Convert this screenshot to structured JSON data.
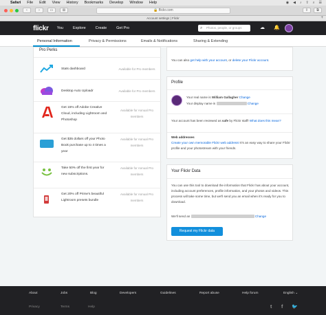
{
  "menubar": {
    "items": [
      "Safari",
      "File",
      "Edit",
      "View",
      "History",
      "Bookmarks",
      "Develop",
      "Window",
      "Help"
    ],
    "status": [
      "◉",
      "◀",
      "♪",
      "⇪",
      "⌕",
      "☰"
    ]
  },
  "browser": {
    "url": "🔒 flickr.com",
    "tab_title": "Account settings | Flickr"
  },
  "nav": {
    "logo": "flickr",
    "links": [
      "You",
      "Explore",
      "Create",
      "Get Pro"
    ],
    "search_placeholder": "Photos, people, or groups"
  },
  "settings_tabs": [
    "Personal Information",
    "Privacy & Permissions",
    "Emails & Notifications",
    "Sharing & Extending"
  ],
  "perks": {
    "title": "Pro Perks",
    "items": [
      {
        "text": "Stats dashboard",
        "avail": "Available for Pro members",
        "icon": "stats-chart-icon"
      },
      {
        "text": "Desktop Auto Uploadr",
        "avail": "Available for Pro members",
        "icon": "cloud-upload-icon"
      },
      {
        "text": "Get 15% off Adobe Creative Cloud, including Lightroom and Photoshop",
        "avail": "Available for Annual Pro members",
        "icon": "adobe-icon"
      },
      {
        "text": "Get $35 dollars off your Photo Book purchase up to 4 times a year",
        "avail": "Available for Annual Pro members",
        "icon": "blurb-icon"
      },
      {
        "text": "Take 50% off the first year for new subscriptions.",
        "avail": "Available for Annual Pro members",
        "icon": "smiley-icon"
      },
      {
        "text": "Get 20% off Prime's beautiful Lightroom presets bundle",
        "avail": "Available for Annual Pro members",
        "icon": "prime-icon"
      }
    ]
  },
  "account": {
    "pre": "You can also ",
    "link1": "get help with your account",
    "mid": ", or ",
    "link2": "delete your Flickr account",
    "post": "."
  },
  "profile": {
    "title": "Profile",
    "real_name_label": "Your real name is",
    "real_name": "William Gallagher",
    "change": "Change",
    "display_name_label": "Your display name is",
    "safe_pre": "Your account has been reviewed as",
    "safe_word": "safe",
    "safe_post": "by Flickr staff!",
    "safe_link": "What does this mean?",
    "web_title": "Web addresses",
    "web_link": "Create your own memorable Flickr web address!",
    "web_post": "It's an easy way to share your Flickr profile and your photostream with your friends."
  },
  "your_data": {
    "title": "Your Flickr Data",
    "body": "You can use this tool to download the information that Flickr has about your account, including account preferences, profile information, and your photos and videos. This process will take some time, but we'll send you an email when it's ready for you to download.",
    "send_label": "We'll send an",
    "change": "Change",
    "button": "Request my Flickr data"
  },
  "footer": {
    "row1": [
      "About",
      "Jobs",
      "Blog",
      "Developers",
      "Guidelines",
      "Report abuse",
      "Help forum",
      "English ⌄"
    ],
    "row2": [
      "Privacy",
      "Terms",
      "Help"
    ],
    "social": [
      "t",
      "f",
      "🐦"
    ]
  },
  "colors": {
    "accent": "#008ecf",
    "link": "#0063dc",
    "nav_bg": "#212124",
    "button": "#128fdc"
  }
}
